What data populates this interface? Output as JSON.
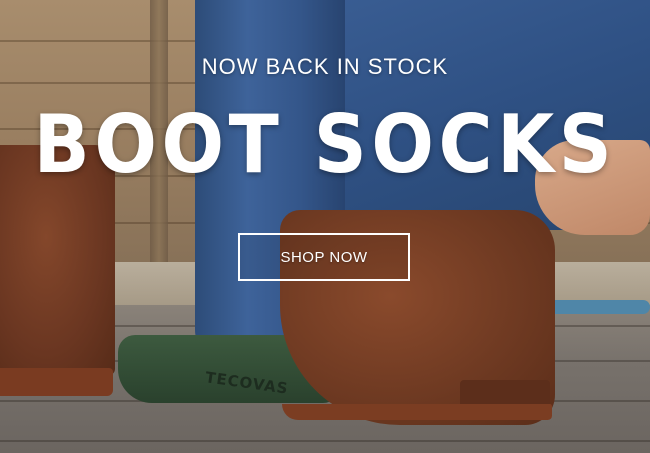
{
  "hero": {
    "eyebrow": "NOW BACK IN STOCK",
    "headline": "BOOT SOCKS",
    "cta_label": "SHOP NOW",
    "sock_brand": "TECOVAS"
  },
  "colors": {
    "text": "#ffffff",
    "sock_green": "#314b34",
    "boot_brown": "#6f3a22",
    "denim": "#34568a"
  }
}
